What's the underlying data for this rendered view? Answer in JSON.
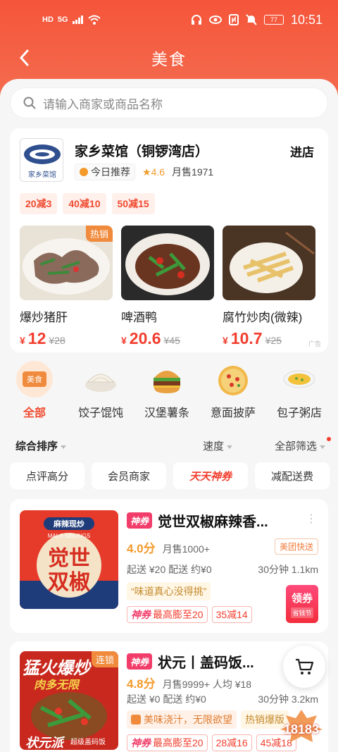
{
  "status": {
    "time": "10:51",
    "battery": "77",
    "hd": "HD",
    "net": "5G"
  },
  "nav": {
    "title": "美食"
  },
  "search": {
    "placeholder": "请输入商家或商品名称"
  },
  "shop": {
    "name": "家乡菜馆（铜锣湾店）",
    "enter": "进店",
    "logo_text": "家乡菜馆",
    "recommend": "今日推荐",
    "rating": "4.6",
    "monthly": "月售1971",
    "discounts": [
      "20减3",
      "40减10",
      "50减15"
    ],
    "dishes": [
      {
        "name": "爆炒猪肝",
        "yen": "¥",
        "price": "12",
        "orig": "¥28",
        "badge": "热销"
      },
      {
        "name": "啤酒鸭",
        "yen": "¥",
        "price": "20.6",
        "orig": "¥45",
        "badge": ""
      },
      {
        "name": "腐竹炒肉(微辣)",
        "yen": "¥",
        "price": "10.7",
        "orig": "¥25",
        "badge": ""
      }
    ],
    "ad": "广告"
  },
  "categories": [
    {
      "label": "全部",
      "badge": "美食",
      "active": true
    },
    {
      "label": "饺子馄饨"
    },
    {
      "label": "汉堡薯条"
    },
    {
      "label": "意面披萨"
    },
    {
      "label": "包子粥店"
    }
  ],
  "sorts": {
    "main": "综合排序",
    "speed": "速度",
    "all": "全部筛选"
  },
  "filters": [
    "点评高分",
    "会员商家",
    "天天神券",
    "减配送费"
  ],
  "stores": [
    {
      "tag": "神券",
      "name": "觉世双椒麻辣香...",
      "score": "4.0分",
      "sales": "月售1000+",
      "fast": "美团快送",
      "delivery": "起送 ¥20  配送 约¥0",
      "time_dist": "30分钟  1.1km",
      "quote": "“味道真心没得挑”",
      "promos": [
        "最高膨至20",
        "35减14"
      ],
      "promo_tag": "神券",
      "coupon_main": "领券",
      "coupon_sub": "省钱节",
      "thumb_text": "觉世双椒",
      "thumb_sub": "麻辣现炒",
      "thumb_en": "MALA SIBLINGS"
    },
    {
      "tag": "神券",
      "name": "状元丨盖码饭...",
      "score": "4.8分",
      "sales": "月售9999+  人均 ¥18",
      "delivery": "起送 ¥0  配送 约¥0",
      "time_dist": "30分钟  3.2km",
      "highlight1": "美味浇汁，无限欲望",
      "highlight2": "热销爆版",
      "promos": [
        "最高膨至20",
        "28减16",
        "45减18"
      ],
      "promo_tag": "神券",
      "lock": "连锁",
      "thumb_text": "猛火爆炒",
      "thumb_sub": "肉多无限",
      "thumb_brand": "状元派",
      "thumb_brand2": "超级盖码饭"
    }
  ],
  "watermark": "18183"
}
